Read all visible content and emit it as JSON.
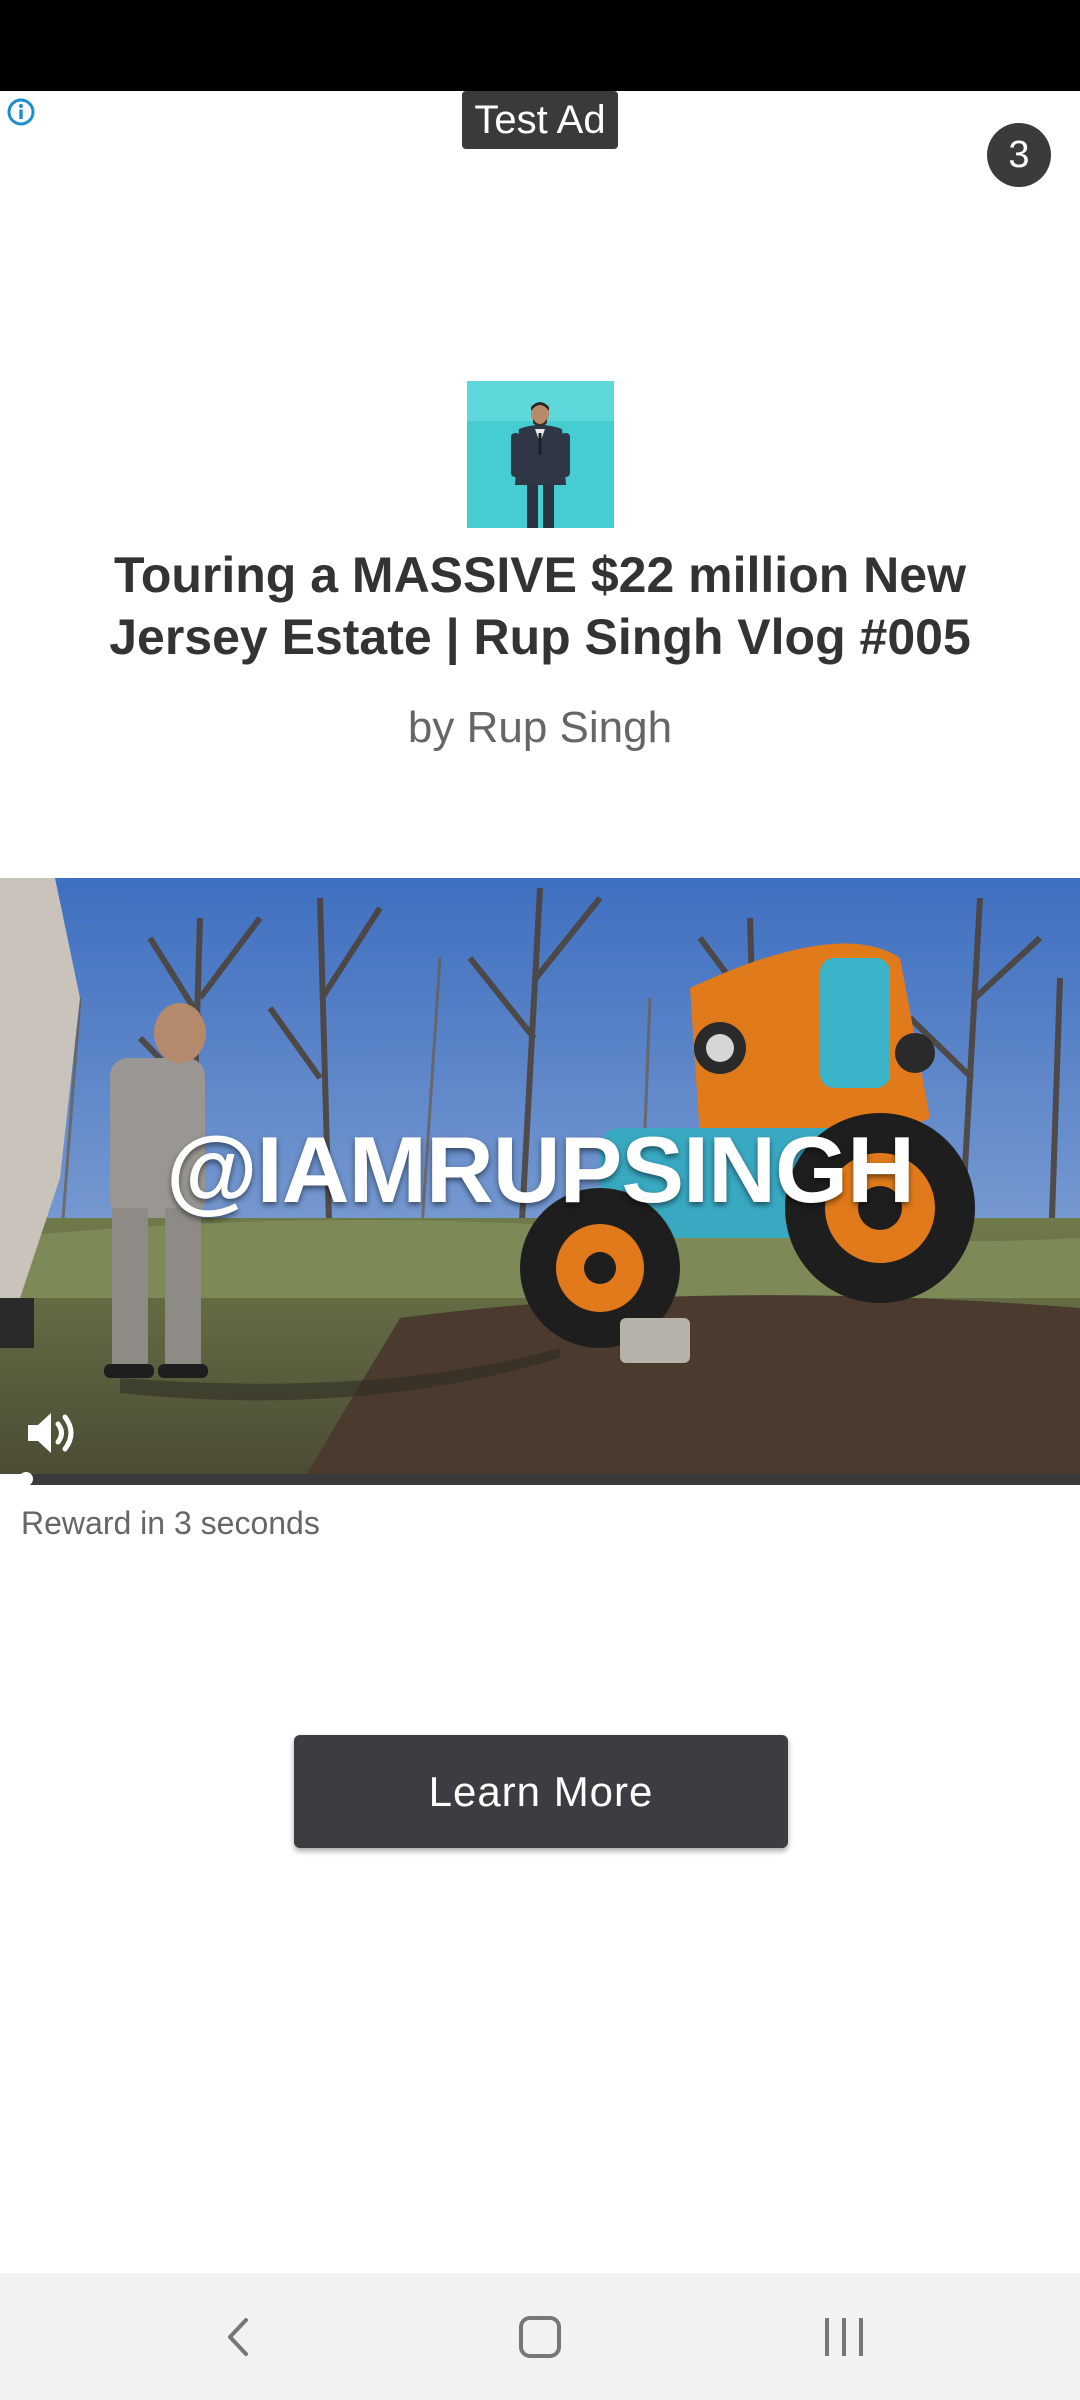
{
  "ad": {
    "label": "Test Ad",
    "countdown": "3",
    "info_icon": "info-circle-icon",
    "title": "Touring a MASSIVE $22 million New Jersey Estate | Rup Singh Vlog #005",
    "byline": "by Rup Singh",
    "thumbnail": "person-in-suit-thumbnail"
  },
  "video": {
    "overlay_text": "@IAMRUPSINGH",
    "sound_icon": "speaker-on-icon",
    "progress": 0.02,
    "reward_text": "Reward in 3 seconds"
  },
  "cta": {
    "label": "Learn More"
  },
  "navbar": {
    "back_icon": "back-chevron-icon",
    "home_icon": "home-square-icon",
    "recents_icon": "recents-lines-icon"
  },
  "colors": {
    "status_bar": "#000000",
    "cta_background": "#3b3d40",
    "badge_background": "#3b3b3b",
    "info_icon": "#1a8fd0"
  }
}
